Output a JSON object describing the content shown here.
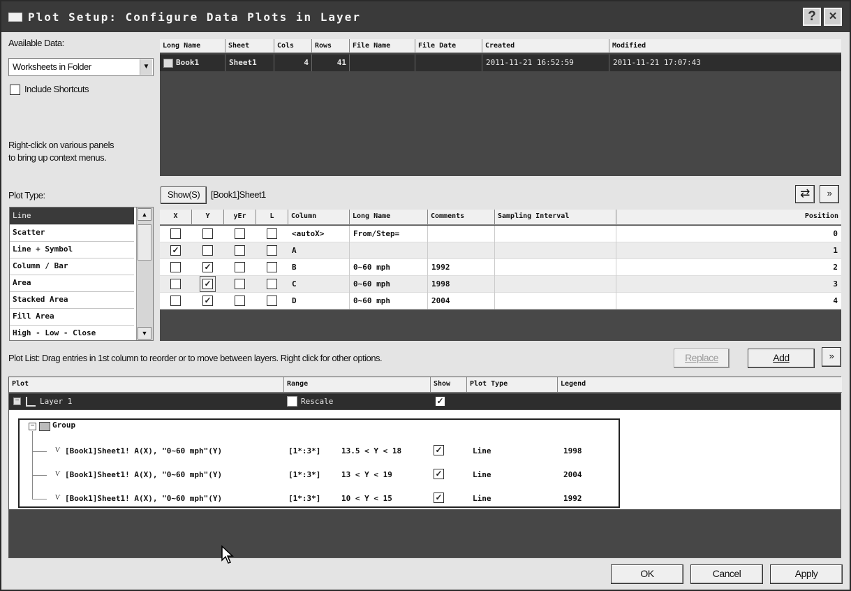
{
  "window": {
    "title": "Plot Setup: Configure Data Plots in Layer",
    "help_label": "?",
    "close_label": "×"
  },
  "available": {
    "label": "Available Data:",
    "select_value": "Worksheets in Folder",
    "shortcuts_label": "Include Shortcuts",
    "hint": [
      "Right-click on various panels",
      "to bring up context menus."
    ]
  },
  "book_table": {
    "headers": [
      "Long Name",
      "Sheet",
      "Cols",
      "Rows",
      "File Name",
      "File Date",
      "Created",
      "Modified"
    ],
    "rows": [
      {
        "long_name": "Book1",
        "sheet": "Sheet1",
        "cols": "4",
        "rows": "41",
        "file_name": "",
        "file_date": "",
        "created": "2011-11-21 16:52:59",
        "modified": "2011-11-21 17:07:43"
      }
    ]
  },
  "plot_type": {
    "label": "Plot Type:",
    "items": [
      "Line",
      "Scatter",
      "Line + Symbol",
      "Column / Bar",
      "Area",
      "Stacked Area",
      "Fill Area",
      "High - Low - Close"
    ],
    "selected": 0
  },
  "show_bar": {
    "show_label": "Show(S)",
    "path": "[Book1]Sheet1",
    "swap_icon": "swap-arrows",
    "expand_icon": "double-chevron-down"
  },
  "col_table": {
    "headers": [
      "X",
      "Y",
      "yEr",
      "L",
      "Column",
      "Long Name",
      "Comments",
      "Sampling Interval",
      "Position"
    ],
    "rows": [
      {
        "x": false,
        "y": false,
        "yer": false,
        "l": false,
        "column": "<autoX>",
        "long_name": "From/Step=",
        "comments": "",
        "position": "0"
      },
      {
        "x": true,
        "y": false,
        "yer": false,
        "l": false,
        "column": "A",
        "long_name": "",
        "comments": "",
        "position": "1"
      },
      {
        "x": false,
        "y": true,
        "yer": false,
        "l": false,
        "column": "B",
        "long_name": "0~60 mph",
        "comments": "1992",
        "position": "2"
      },
      {
        "x": false,
        "y": true,
        "yer": false,
        "l": false,
        "column": "C",
        "long_name": "0~60 mph",
        "comments": "1998",
        "position": "3"
      },
      {
        "x": false,
        "y": true,
        "yer": false,
        "l": false,
        "column": "D",
        "long_name": "0~60 mph",
        "comments": "2004",
        "position": "4"
      }
    ]
  },
  "plot_list": {
    "hint": "Plot List: Drag entries in 1st column to reorder or to move between layers. Right click for other options.",
    "replace_label": "Replace",
    "add_label": "Add",
    "headers": [
      "Plot",
      "Range",
      "Show",
      "Plot Type",
      "Legend"
    ],
    "layer": {
      "name": "Layer 1",
      "rescale": "Rescale",
      "show": true
    },
    "group_label": "Group",
    "entries": [
      {
        "plot": "[Book1]Sheet1! A(X), \"0~60 mph\"(Y)",
        "range": "[1*:3*]",
        "condition": "13.5 < Y < 18",
        "show": true,
        "type": "Line",
        "legend": "1998"
      },
      {
        "plot": "[Book1]Sheet1! A(X), \"0~60 mph\"(Y)",
        "range": "[1*:3*]",
        "condition": "13 < Y < 19",
        "show": true,
        "type": "Line",
        "legend": "2004"
      },
      {
        "plot": "[Book1]Sheet1! A(X), \"0~60 mph\"(Y)",
        "range": "[1*:3*]",
        "condition": "10 < Y < 15",
        "show": true,
        "type": "Line",
        "legend": "1992"
      }
    ]
  },
  "footer": {
    "ok_label": "OK",
    "cancel_label": "Cancel",
    "apply_label": "Apply"
  }
}
